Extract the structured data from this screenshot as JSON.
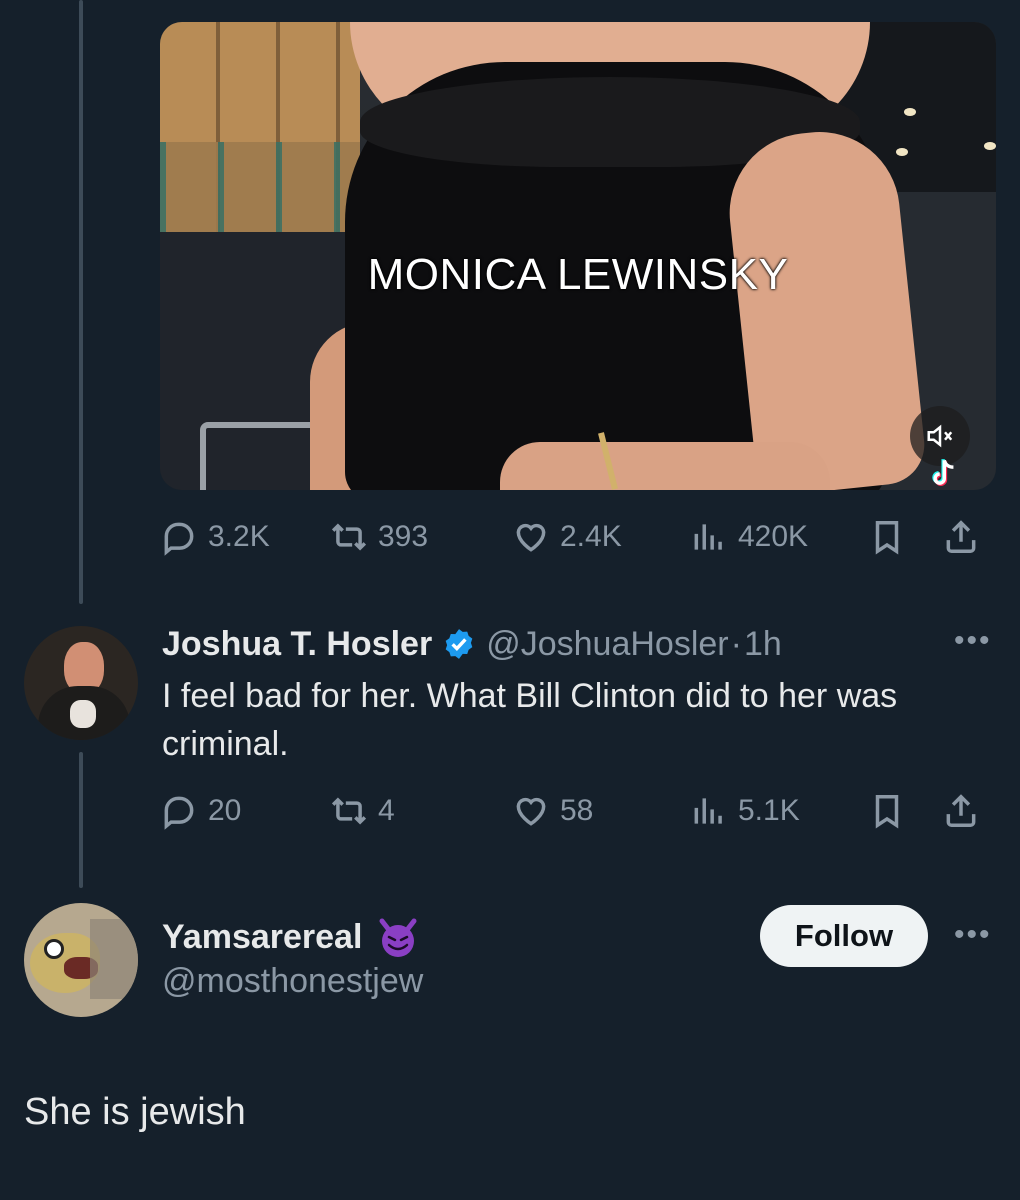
{
  "video": {
    "caption": "MONICA LEWINSKY",
    "mute_icon": "mute-icon",
    "watermark_icon": "tiktok-icon"
  },
  "main_actions": {
    "replies": "3.2K",
    "reposts": "393",
    "likes": "2.4K",
    "views": "420K"
  },
  "reply_tweet": {
    "display_name": "Joshua T. Hosler",
    "verified": true,
    "handle": "@JoshuaHosler",
    "separator": "·",
    "time": "1h",
    "more": "•••",
    "text": "I feel bad for her. What Bill Clinton did to her was criminal.",
    "replies": "20",
    "reposts": "4",
    "likes": "58",
    "views": "5.1K"
  },
  "quoted_user": {
    "display_name": "Yamsarereal",
    "emoji_icon": "smiling-devil-icon",
    "handle": "@mosthonestjew",
    "follow_label": "Follow",
    "more": "•••",
    "text": "She is jewish"
  },
  "colors": {
    "background": "#15202b",
    "verified_blue": "#1d9bf0",
    "devil_purple": "#8a3fc4",
    "muted_text": "#8b98a5"
  }
}
